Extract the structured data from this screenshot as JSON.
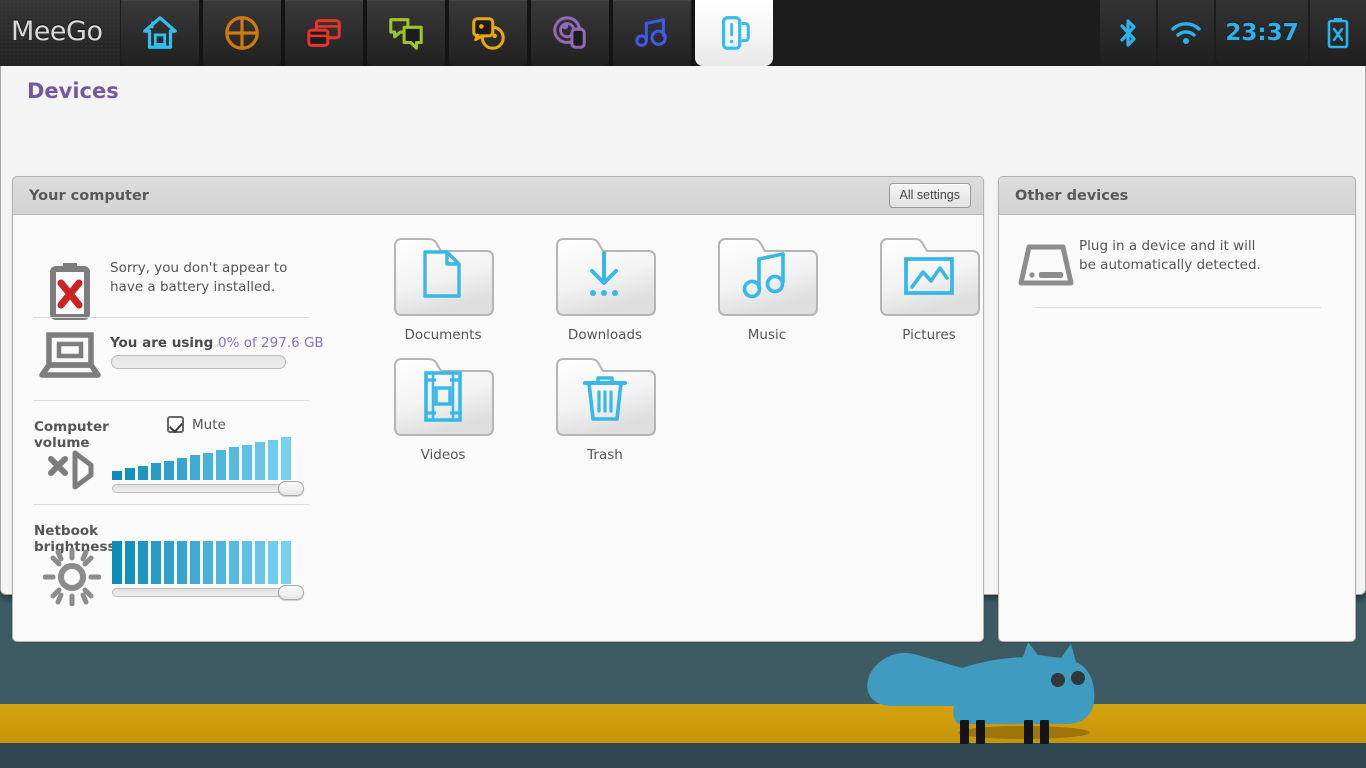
{
  "topbar": {
    "logo": "MeeGo",
    "tabs": [
      {
        "name": "myzone",
        "icon": "home-icon",
        "color": "#35bdf0",
        "active": false
      },
      {
        "name": "zones",
        "icon": "zones-icon",
        "color": "#d07a0c",
        "active": false
      },
      {
        "name": "applications",
        "icon": "windows-icon",
        "color": "#e8352c",
        "active": false
      },
      {
        "name": "status",
        "icon": "chat-icon",
        "color": "#9bc62c",
        "active": false
      },
      {
        "name": "people",
        "icon": "people-icon",
        "color": "#e9a90e",
        "active": false
      },
      {
        "name": "internet",
        "icon": "internet-icon",
        "color": "#9269b8",
        "active": false
      },
      {
        "name": "media",
        "icon": "music-icon",
        "color": "#4158e8",
        "active": false
      },
      {
        "name": "devices",
        "icon": "devices-icon",
        "color": "#35bdf0",
        "active": true
      }
    ],
    "status": {
      "bluetooth_icon": "bluetooth-icon",
      "wifi_icon": "wifi-icon",
      "clock": "23:37",
      "battery_icon": "battery-missing-icon",
      "accent": "#2ab3ee"
    }
  },
  "page": {
    "title": "Devices",
    "title_color": "#74589c"
  },
  "computer_panel": {
    "title": "Your computer",
    "all_settings_label": "All settings",
    "battery": {
      "icon": "battery-missing-icon",
      "message": "Sorry, you don't appear to have a battery installed."
    },
    "disk": {
      "icon": "laptop-icon",
      "lead_text": "You are using ",
      "value_text": "0% of 297.6 GB",
      "percent": 0,
      "total": "297.6 GB",
      "value_color": "#8a73bb"
    },
    "volume": {
      "label": "Computer volume",
      "mute_label": "Mute",
      "mute_checked": true,
      "icon": "speaker-muted-icon",
      "level_percent": 97,
      "bar_count": 14
    },
    "brightness": {
      "label": "Netbook brightness",
      "icon": "sun-icon",
      "level_percent": 97,
      "bar_count": 14
    },
    "folders": [
      {
        "label": "Documents",
        "icon": "document-icon"
      },
      {
        "label": "Downloads",
        "icon": "download-icon"
      },
      {
        "label": "Music",
        "icon": "music-note-icon"
      },
      {
        "label": "Pictures",
        "icon": "image-icon"
      },
      {
        "label": "Videos",
        "icon": "filmstrip-icon"
      },
      {
        "label": "Trash",
        "icon": "trash-icon"
      }
    ]
  },
  "other_panel": {
    "title": "Other devices",
    "icon": "external-drive-icon",
    "message_line1": "Plug in a device and it will",
    "message_line2": "be automatically detected."
  },
  "wallpaper": {
    "description": "dark teal forest with golden band and blue fox",
    "sky_top": "#1d3036",
    "sky_bottom": "#3f5c64",
    "band_color": "#cf9d0b",
    "fox_color": "#3f9cc0"
  }
}
